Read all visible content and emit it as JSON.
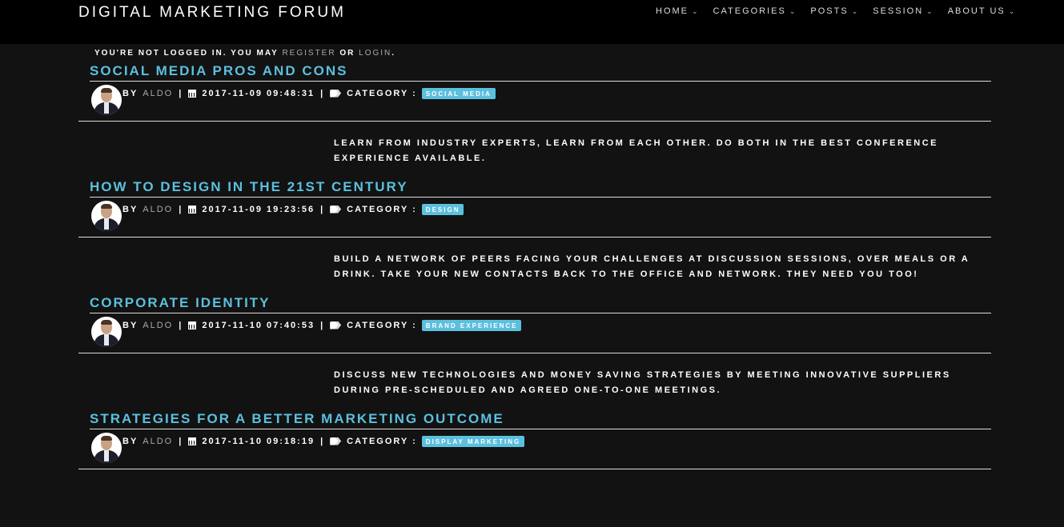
{
  "header": {
    "brand": "DIGITAL MARKETING FORUM",
    "nav": [
      {
        "label": "HOME"
      },
      {
        "label": "CATEGORIES"
      },
      {
        "label": "POSTS"
      },
      {
        "label": "SESSION"
      },
      {
        "label": "ABOUT US"
      }
    ]
  },
  "notice": {
    "prefix": "YOU'RE NOT LOGGED IN. YOU MAY",
    "register": "REGISTER",
    "or": "OR",
    "login": "LOGIN",
    "suffix": "."
  },
  "colors": {
    "accent": "#5bc0de",
    "background": "#121212",
    "topbar": "#000000"
  },
  "meta_labels": {
    "by": "BY",
    "separator": "|",
    "category": "CATEGORY :"
  },
  "posts": [
    {
      "title": "SOCIAL MEDIA PROS AND CONS",
      "author": "ALDO",
      "datetime": "2017-11-09 09:48:31",
      "category": "SOCIAL MEDIA",
      "excerpt": "LEARN FROM INDUSTRY EXPERTS, LEARN FROM EACH OTHER. DO BOTH IN THE BEST CONFERENCE EXPERIENCE AVAILABLE."
    },
    {
      "title": "HOW TO DESIGN IN THE 21ST CENTURY",
      "author": "ALDO",
      "datetime": "2017-11-09 19:23:56",
      "category": "DESIGN",
      "excerpt": "BUILD A NETWORK OF PEERS FACING YOUR CHALLENGES AT DISCUSSION SESSIONS, OVER MEALS OR A DRINK. TAKE YOUR NEW CONTACTS BACK TO THE OFFICE AND NETWORK. THEY NEED YOU TOO!"
    },
    {
      "title": "CORPORATE IDENTITY",
      "author": "ALDO",
      "datetime": "2017-11-10 07:40:53",
      "category": "BRAND EXPERIENCE",
      "excerpt": "DISCUSS NEW TECHNOLOGIES AND MONEY SAVING STRATEGIES BY MEETING INNOVATIVE SUPPLIERS DURING PRE-SCHEDULED AND AGREED ONE-TO-ONE MEETINGS."
    },
    {
      "title": "STRATEGIES FOR A BETTER MARKETING OUTCOME",
      "author": "ALDO",
      "datetime": "2017-11-10 09:18:19",
      "category": "DISPLAY MARKETING",
      "excerpt": ""
    }
  ]
}
